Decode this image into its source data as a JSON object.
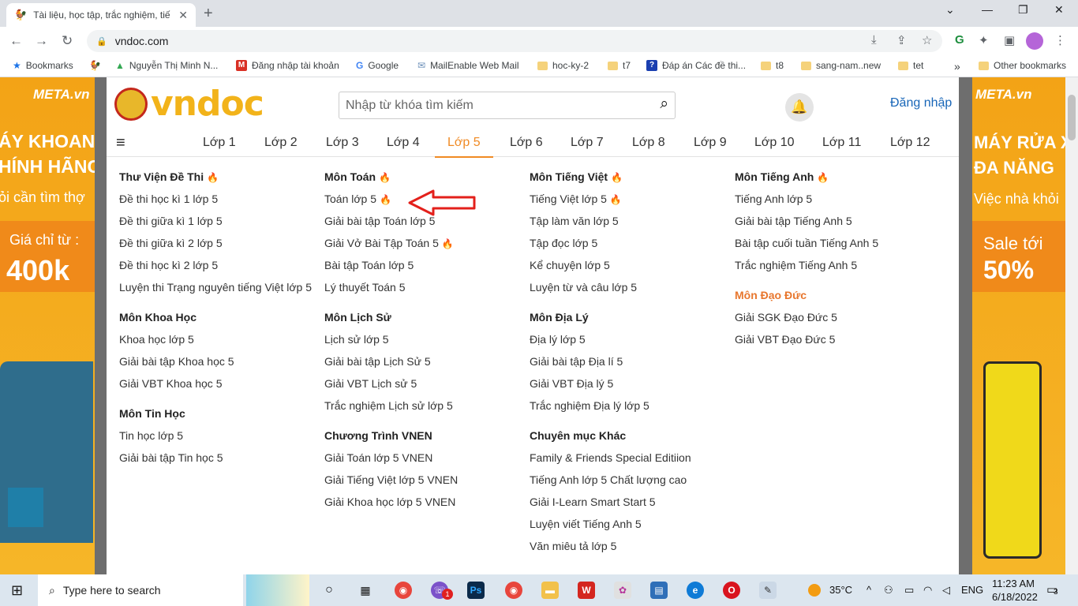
{
  "browser": {
    "tab_title": "Tài liệu, học tập, trắc nghiệm, tiế",
    "url": "vndoc.com",
    "bookmarks": [
      {
        "label": "Bookmarks",
        "icon": "star-icon"
      },
      {
        "label": "",
        "icon": "rooster-icon"
      },
      {
        "label": "Nguyễn Thị Minh N...",
        "icon": "drive-icon"
      },
      {
        "label": "Đăng nhập tài khoản",
        "icon": "m-icon"
      },
      {
        "label": "Google",
        "icon": "google-icon"
      },
      {
        "label": "MailEnable Web Mail",
        "icon": "mail-icon"
      },
      {
        "label": "hoc-ky-2",
        "icon": "folder-icon"
      },
      {
        "label": "t7",
        "icon": "folder-icon"
      },
      {
        "label": "Đáp án Các đề thi...",
        "icon": "page-icon"
      },
      {
        "label": "t8",
        "icon": "folder-icon"
      },
      {
        "label": "sang-nam..new",
        "icon": "folder-icon"
      },
      {
        "label": "tet",
        "icon": "folder-icon"
      },
      {
        "label": "»",
        "icon": "more-icon"
      },
      {
        "label": "Other bookmarks",
        "icon": "folder-icon"
      }
    ]
  },
  "ads": {
    "left": {
      "brand": "META.vn",
      "line1": "ÁY KHOAN",
      "line2": "HÍNH HÃNG",
      "line3": "ỏi cần tìm thợ",
      "line4": "Giá chỉ từ :",
      "price": "400k"
    },
    "right": {
      "brand": "META.vn",
      "line1": "MÁY RỬA X",
      "line2": "ĐA NĂNG",
      "line3": "Việc nhà khỏi",
      "line4": "Sale tới",
      "price": "50%"
    }
  },
  "site": {
    "search_placeholder": "Nhập từ khóa tìm kiếm",
    "login": "Đăng nhập",
    "grades": [
      "Lớp 1",
      "Lớp 2",
      "Lớp 3",
      "Lớp 4",
      "Lớp 5",
      "Lớp 6",
      "Lớp 7",
      "Lớp 8",
      "Lớp 9",
      "Lớp 10",
      "Lớp 11",
      "Lớp 12"
    ],
    "active_grade": "Lớp 5",
    "columns": [
      [
        {
          "title": "Thư Viện Đề Thi",
          "hot": true,
          "links": [
            {
              "t": "Đề thi học kì 1 lớp 5"
            },
            {
              "t": "Đề thi giữa kì 1 lớp 5"
            },
            {
              "t": "Đề thi giữa kì 2 lớp 5"
            },
            {
              "t": "Đề thi học kì 2 lớp 5"
            },
            {
              "t": "Luyện thi Trạng nguyên tiếng Việt lớp 5"
            }
          ]
        },
        {
          "title": "Môn Khoa Học",
          "links": [
            {
              "t": "Khoa học lớp 5"
            },
            {
              "t": "Giải bài tập Khoa học 5"
            },
            {
              "t": "Giải VBT Khoa học 5"
            }
          ]
        },
        {
          "title": "Môn Tin Học",
          "links": [
            {
              "t": "Tin học lớp 5"
            },
            {
              "t": "Giải bài tập Tin học 5"
            }
          ]
        }
      ],
      [
        {
          "title": "Môn Toán",
          "hot": true,
          "links": [
            {
              "t": "Toán lớp 5",
              "hot": true
            },
            {
              "t": "Giải bài tập Toán lớp 5"
            },
            {
              "t": "Giải Vở Bài Tập Toán 5",
              "hot": true
            },
            {
              "t": "Bài tập Toán lớp 5"
            },
            {
              "t": "Lý thuyết Toán 5"
            }
          ]
        },
        {
          "title": "Môn Lịch Sử",
          "links": [
            {
              "t": "Lịch sử lớp 5"
            },
            {
              "t": "Giải bài tập Lịch Sử 5"
            },
            {
              "t": "Giải VBT Lịch sử 5"
            },
            {
              "t": "Trắc nghiệm Lịch sử lớp 5"
            }
          ]
        },
        {
          "title": "Chương Trình VNEN",
          "links": [
            {
              "t": "Giải Toán lớp 5 VNEN"
            },
            {
              "t": "Giải Tiếng Việt lớp 5 VNEN"
            },
            {
              "t": "Giải Khoa học lớp 5 VNEN"
            }
          ]
        }
      ],
      [
        {
          "title": "Môn Tiếng Việt",
          "hot": true,
          "links": [
            {
              "t": "Tiếng Việt lớp 5",
              "hot": true
            },
            {
              "t": "Tập làm văn lớp 5"
            },
            {
              "t": "Tập đọc lớp 5"
            },
            {
              "t": "Kể chuyện lớp 5"
            },
            {
              "t": "Luyện từ và câu lớp 5"
            }
          ]
        },
        {
          "title": "Môn Địa Lý",
          "links": [
            {
              "t": "Địa lý lớp 5"
            },
            {
              "t": "Giải bài tập Địa lí 5"
            },
            {
              "t": "Giải VBT Địa lý 5"
            },
            {
              "t": "Trắc nghiệm Địa lý lớp 5"
            }
          ]
        },
        {
          "title": "Chuyên mục Khác",
          "links": [
            {
              "t": "Family & Friends Special Editiion"
            },
            {
              "t": "Tiếng Anh lớp 5 Chất lượng cao"
            },
            {
              "t": "Giải I-Learn Smart Start 5"
            },
            {
              "t": "Luyện viết Tiếng Anh 5"
            },
            {
              "t": "Văn miêu tả lớp 5"
            }
          ]
        }
      ],
      [
        {
          "title": "Môn Tiếng Anh",
          "hot": true,
          "links": [
            {
              "t": "Tiếng Anh lớp 5"
            },
            {
              "t": "Giải bài tập Tiếng Anh 5"
            },
            {
              "t": "Bài tập cuối tuần Tiếng Anh 5"
            },
            {
              "t": "Trắc nghiệm Tiếng Anh 5"
            }
          ]
        },
        {
          "title": "Môn Đạo Đức",
          "orange": true,
          "links": [
            {
              "t": "Giải SGK Đạo Đức 5"
            },
            {
              "t": "Giải VBT Đạo Đức 5"
            }
          ]
        }
      ]
    ]
  },
  "taskbar": {
    "search": "Type here to search",
    "weather": "35°C",
    "lang": "ENG",
    "time": "11:23 AM",
    "date": "6/18/2022",
    "notifications": "3",
    "badge": "1"
  },
  "colors": {
    "accent": "#f08a24",
    "link": "#1866b8",
    "ad": "#f3a316"
  }
}
